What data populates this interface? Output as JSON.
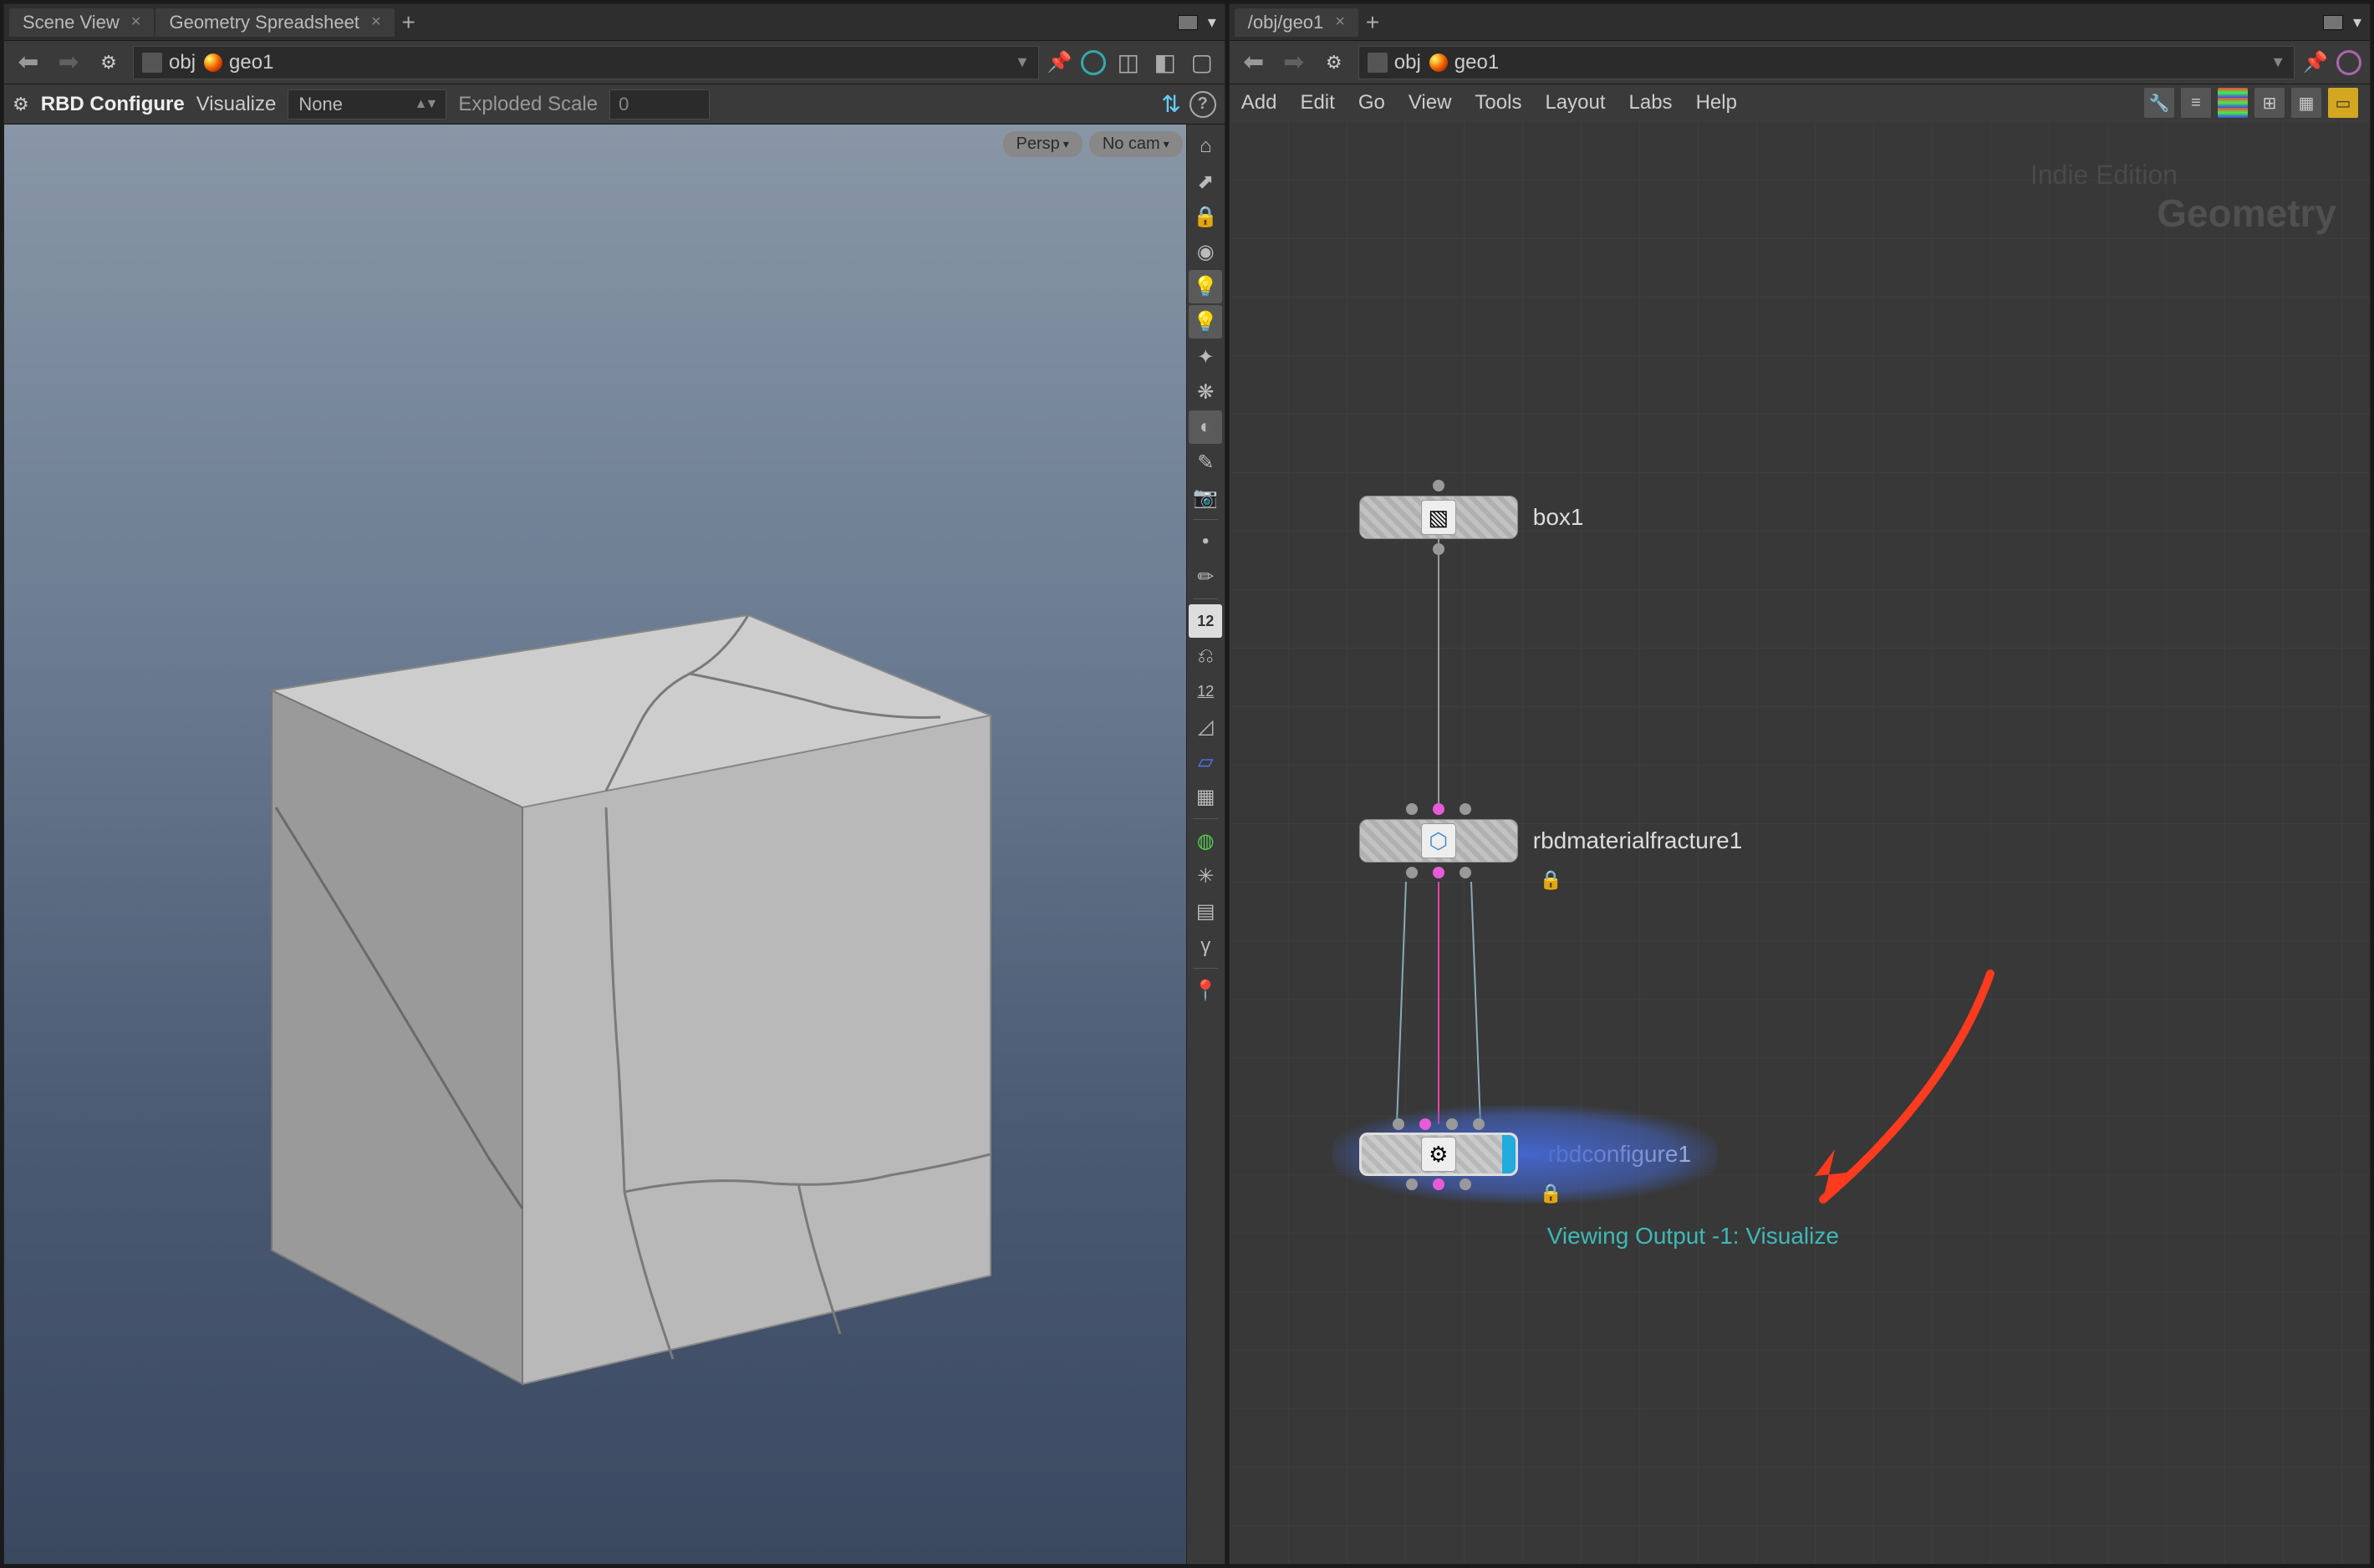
{
  "left": {
    "tabs": [
      "Scene View",
      "Geometry Spreadsheet"
    ],
    "path": {
      "segments": [
        "obj",
        "geo1"
      ]
    },
    "toolbar": {
      "title": "RBD Configure",
      "visualize_label": "Visualize",
      "visualize_value": "None",
      "exploded_label": "Exploded Scale",
      "exploded_value": "0"
    },
    "viewport": {
      "camera_pill": "Persp",
      "nocam_pill": "No cam"
    },
    "shelf_badge": "12"
  },
  "right": {
    "tabs": [
      "/obj/geo1"
    ],
    "path": {
      "segments": [
        "obj",
        "geo1"
      ]
    },
    "menu": [
      "Add",
      "Edit",
      "Go",
      "View",
      "Tools",
      "Layout",
      "Labs",
      "Help"
    ],
    "watermark": {
      "line1": "Indie Edition",
      "line2": "Geometry"
    },
    "nodes": {
      "box": "box1",
      "fracture": "rbdmaterialfracture1",
      "configure": "rbdconfigure1"
    },
    "viewing_output": "Viewing Output -1: Visualize"
  }
}
